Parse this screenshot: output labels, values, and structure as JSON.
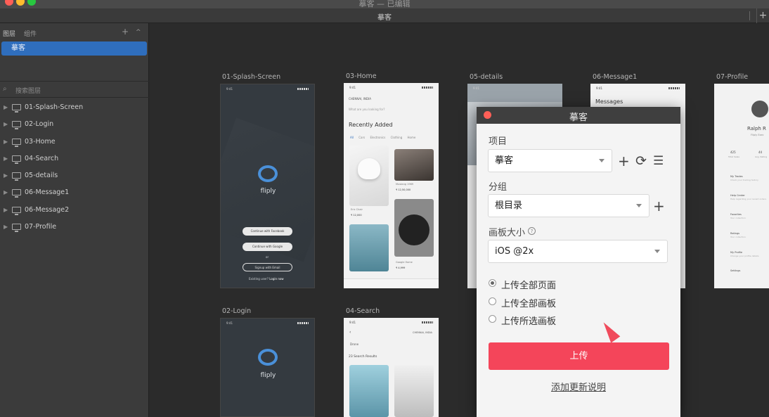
{
  "window": {
    "title": "摹客 — 已编辑",
    "tab_title": "摹客",
    "plus": "+"
  },
  "sidebar": {
    "tab_layers": "图层",
    "tab_components": "组件",
    "plus": "+",
    "collapse": "^",
    "page": "摹客",
    "search_placeholder": "搜索图层",
    "layers": [
      "01-Splash-Screen",
      "02-Login",
      "03-Home",
      "04-Search",
      "05-details",
      "06-Message1",
      "06-Message2",
      "07-Profile"
    ]
  },
  "canvas": {
    "artboards": {
      "splash": "01-Splash-Screen",
      "home": "03-Home",
      "details": "05-details",
      "message": "06-Message1",
      "profile": "07-Profile",
      "login": "02-Login",
      "search": "04-Search"
    },
    "splash": {
      "time": "9:41",
      "app_name": "fliply",
      "btn_facebook": "Continue with Facebook",
      "btn_google": "Continue with Google",
      "or": "or",
      "btn_email": "Signup with Email",
      "footer_q": "Existing user?",
      "footer_login": "Login now"
    },
    "home": {
      "time": "9:41",
      "location": "CHENNAI, INDIA",
      "search": "What are you looking for?",
      "title": "Recently Added",
      "tabs": [
        "All",
        "Cars",
        "Electronics",
        "Clothing",
        "Home"
      ],
      "cards": [
        {
          "name": "Eric Chair",
          "price": "₹ 12,000"
        },
        {
          "name": "Mustang 1969",
          "price": "₹ 12,50,000"
        },
        {
          "name": "Google Home",
          "price": "₹ 4,999"
        }
      ]
    },
    "details": {
      "time": "9:41"
    },
    "message": {
      "time": "9:41",
      "title": "Messages"
    },
    "profile": {
      "name": "Ralph R",
      "location": "Fliply Exec",
      "stats": [
        "425",
        "44"
      ],
      "stat_labels": [
        "Total Sales",
        "Avg. Rating"
      ],
      "items": [
        {
          "title": "My Trades",
          "sub": "Check your trading history"
        },
        {
          "title": "Help Center",
          "sub": "Help regarding your recent orders"
        },
        {
          "title": "Favorites",
          "sub": "Your collection"
        },
        {
          "title": "Ratings",
          "sub": "Your collection"
        },
        {
          "title": "My Profile",
          "sub": "Change your profile details"
        },
        {
          "title": "Settings",
          "sub": ""
        }
      ]
    },
    "login": {
      "time": "9:41",
      "app_name": "fliply"
    },
    "search": {
      "time": "9:41",
      "location": "CHENNAI, INDIA",
      "query": "Drone",
      "results": "23 Search Results"
    }
  },
  "modal": {
    "title": "摹客",
    "project_label": "项目",
    "project_value": "摹客",
    "group_label": "分组",
    "group_value": "根目录",
    "size_label": "画板大小",
    "help": "?",
    "size_value": "iOS @2x",
    "radios": [
      {
        "label": "上传全部页面",
        "checked": true
      },
      {
        "label": "上传全部画板",
        "checked": false
      },
      {
        "label": "上传所选画板",
        "checked": false
      }
    ],
    "icon_add": "+",
    "icon_sync": "⟳",
    "icon_menu": "☰",
    "upload_label": "上传",
    "add_note": "添加更新说明"
  },
  "colors": {
    "accent": "#f4455a",
    "selected": "#2f6ebd",
    "close": "#ff5f57"
  }
}
